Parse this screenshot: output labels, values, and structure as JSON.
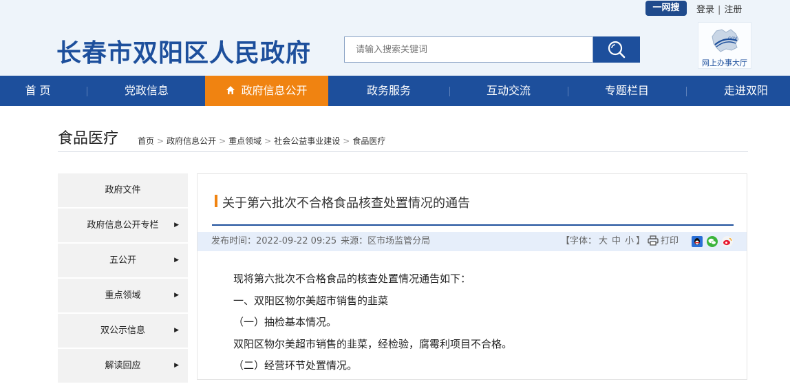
{
  "header": {
    "yiwangsou_label": "一网搜",
    "login_label": "登录",
    "register_label": "注册",
    "site_title": "长春市双阳区人民政府",
    "search_placeholder": "请输入搜索关键词",
    "service_hall_label": "网上办事大厅"
  },
  "nav": {
    "items": [
      "首 页",
      "党政信息",
      "政府信息公开",
      "政务服务",
      "互动交流",
      "专题栏目",
      "走进双阳"
    ],
    "active_index": 2,
    "active_color": "#f08311",
    "bar_color": "#1d4f9c"
  },
  "page": {
    "title": "食品医疗",
    "breadcrumb": [
      "首页",
      "政府信息公开",
      "重点领域",
      "社会公益事业建设",
      "食品医疗"
    ]
  },
  "sidebar": {
    "items": [
      {
        "label": "政府文件",
        "has_arrow": false
      },
      {
        "label": "政府信息公开专栏",
        "has_arrow": true
      },
      {
        "label": "五公开",
        "has_arrow": true
      },
      {
        "label": "重点领域",
        "has_arrow": true
      },
      {
        "label": "双公示信息",
        "has_arrow": true
      },
      {
        "label": "解读回应",
        "has_arrow": true
      }
    ]
  },
  "article": {
    "title": "关于第六批次不合格食品核查处置情况的通告",
    "publish_time": "发布时间：2022-09-22 09:25",
    "source": "来源：区市场监管分局",
    "font_size_prefix": "【字体：",
    "font_sizes": [
      "大",
      "中",
      "小"
    ],
    "font_size_suffix": "】",
    "print_label": "打印",
    "share_icons": [
      "qq-share-icon",
      "wechat-share-icon",
      "weibo-share-icon"
    ],
    "paragraphs": [
      "现将第六批次不合格食品的核查处置情况通告如下：",
      "一、双阳区物尔美超市销售的韭菜",
      "（一）抽检基本情况。",
      "双阳区物尔美超市销售的韭菜，经检验，腐霉利项目不合格。",
      "（二）经营环节处置情况。"
    ]
  }
}
